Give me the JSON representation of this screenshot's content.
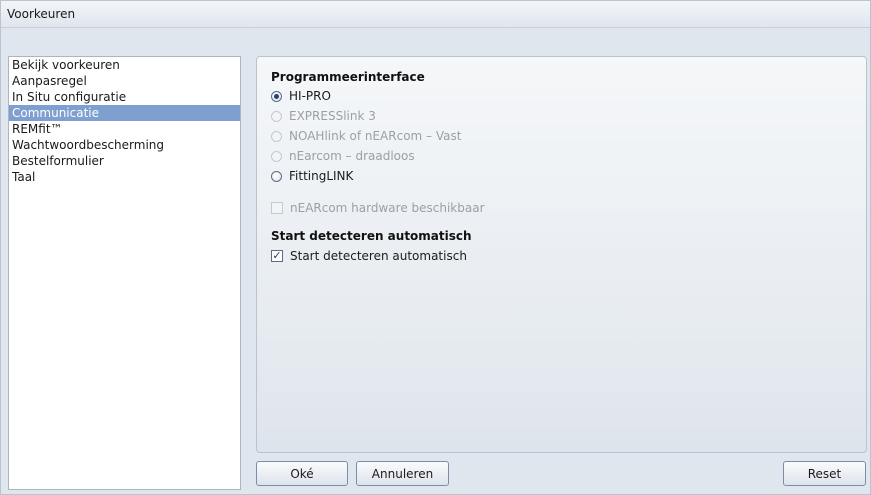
{
  "window": {
    "title": "Voorkeuren"
  },
  "sidebar": {
    "items": [
      {
        "label": "Bekijk voorkeuren",
        "selected": false
      },
      {
        "label": "Aanpasregel",
        "selected": false
      },
      {
        "label": "In Situ configuratie",
        "selected": false
      },
      {
        "label": "Communicatie",
        "selected": true
      },
      {
        "label": "REMfit™",
        "selected": false
      },
      {
        "label": "Wachtwoordbescherming",
        "selected": false
      },
      {
        "label": "Bestelformulier",
        "selected": false
      },
      {
        "label": "Taal",
        "selected": false
      }
    ]
  },
  "programming": {
    "heading": "Programmeerinterface",
    "options": [
      {
        "label": "HI-PRO",
        "checked": true,
        "enabled": true
      },
      {
        "label": "EXPRESSlink 3",
        "checked": false,
        "enabled": false
      },
      {
        "label": "NOAHlink of nEARcom – Vast",
        "checked": false,
        "enabled": false
      },
      {
        "label": "nEarcom – draadloos",
        "checked": false,
        "enabled": false
      },
      {
        "label": "FittingLINK",
        "checked": false,
        "enabled": true
      }
    ],
    "hardware_checkbox": {
      "label": "nEARcom hardware beschikbaar",
      "checked": false,
      "enabled": false
    }
  },
  "autodetect": {
    "heading": "Start detecteren automatisch",
    "checkbox": {
      "label": "Start detecteren automatisch",
      "checked": true,
      "enabled": true
    }
  },
  "buttons": {
    "ok": "Oké",
    "cancel": "Annuleren",
    "reset": "Reset"
  },
  "colors": {
    "selection": "#7f9fd0",
    "window_bg": "#dfe6ee"
  }
}
